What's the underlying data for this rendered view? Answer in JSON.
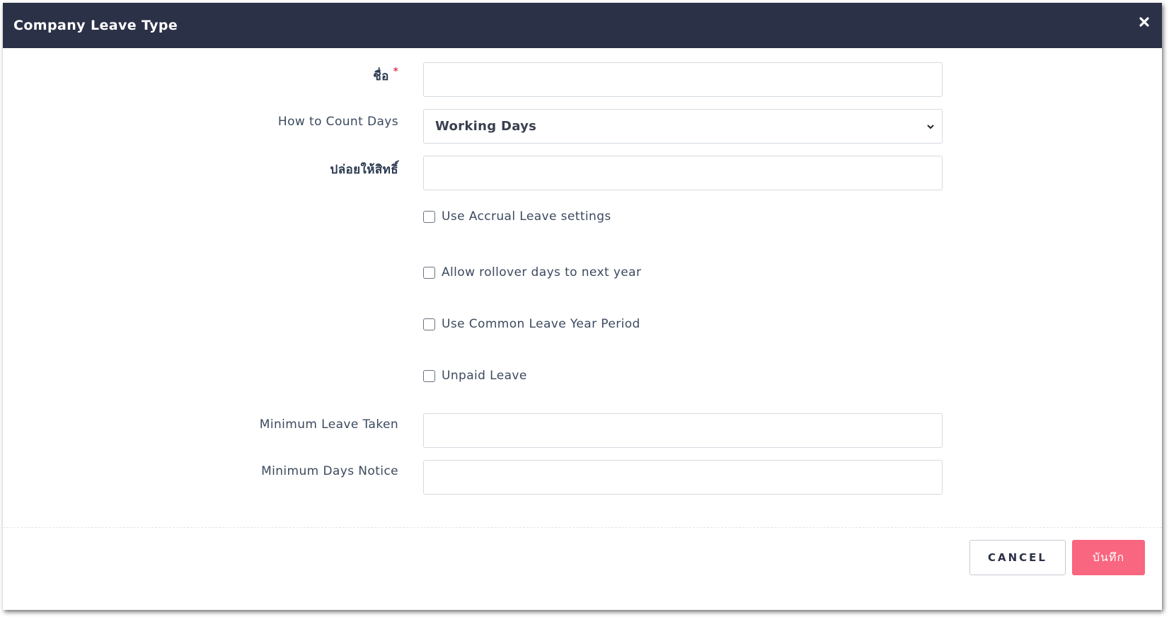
{
  "dialog": {
    "title": "Company Leave Type",
    "close_icon": "close-icon"
  },
  "form": {
    "name": {
      "label": "ชื่อ",
      "required_mark": "*",
      "value": ""
    },
    "count_days": {
      "label": "How to Count Days",
      "selected": "Working Days"
    },
    "release_right": {
      "label": "ปล่อยให้สิทธิ์",
      "value": ""
    },
    "checkboxes": [
      {
        "label": "Use Accrual Leave settings",
        "checked": false
      },
      {
        "label": "Allow rollover days to next year",
        "checked": false
      },
      {
        "label": "Use Common Leave Year Period",
        "checked": false
      },
      {
        "label": "Unpaid Leave",
        "checked": false
      }
    ],
    "min_leave_taken": {
      "label": "Minimum Leave Taken",
      "value": ""
    },
    "min_days_notice": {
      "label": "Minimum Days Notice",
      "value": ""
    }
  },
  "footer": {
    "cancel_label": "CANCEL",
    "save_label": "บันทึก"
  },
  "colors": {
    "header_bg": "#2b3147",
    "save_bg": "#f8667f",
    "required": "#e0334d"
  }
}
